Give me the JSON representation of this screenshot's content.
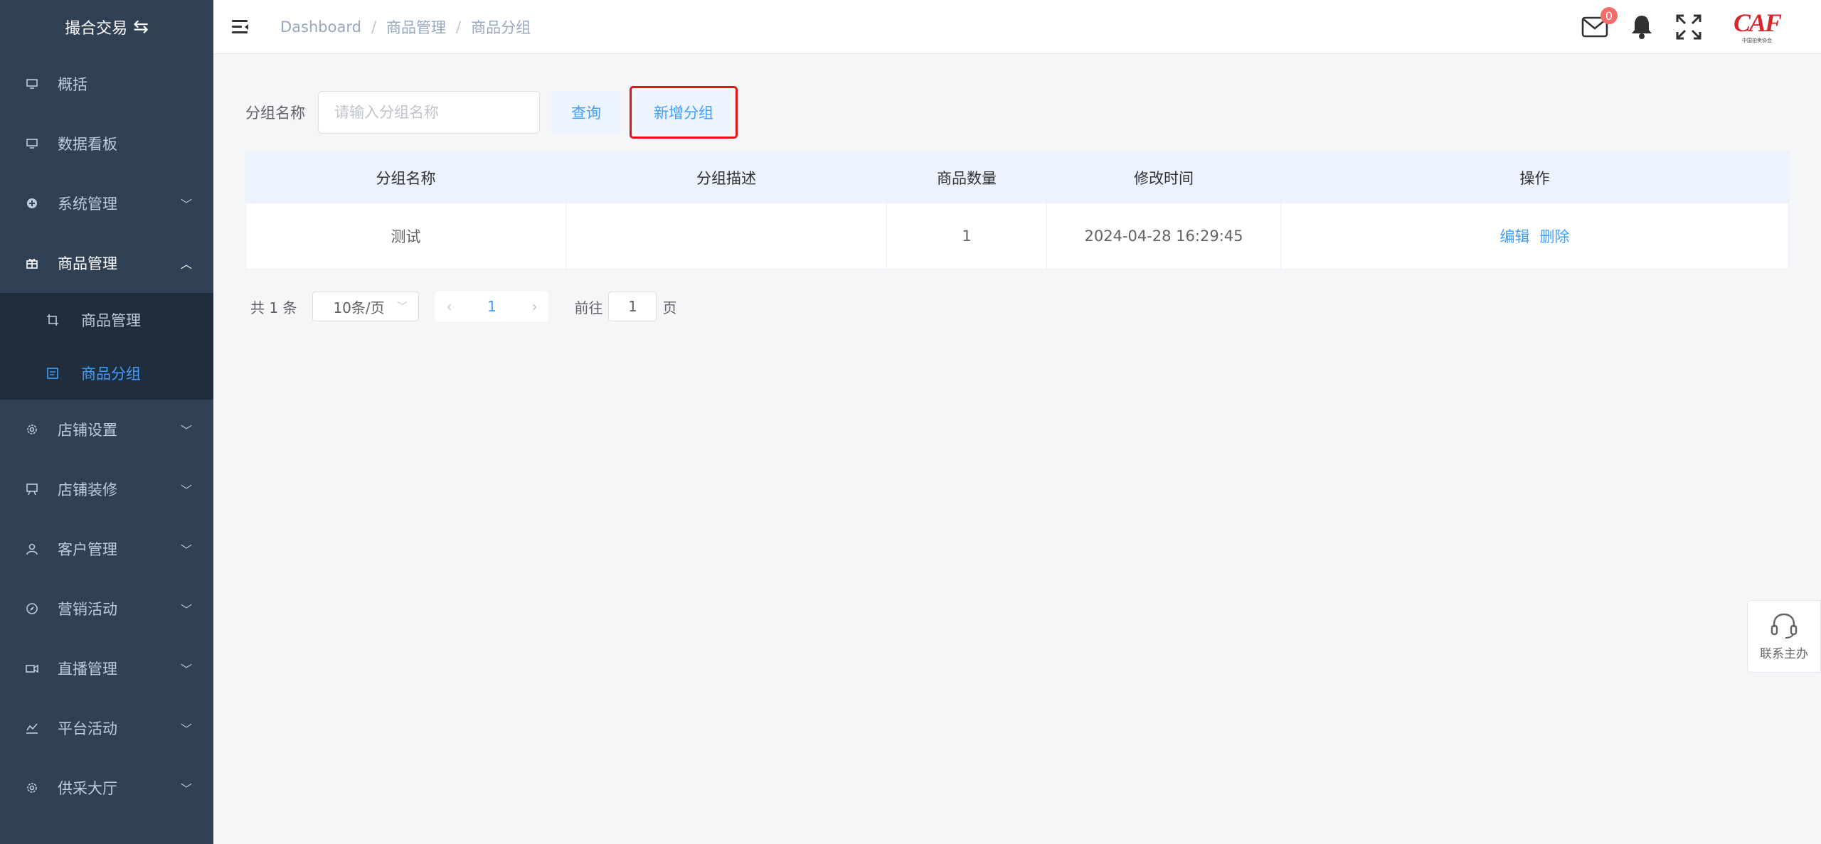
{
  "brand": {
    "title": "撮合交易",
    "swap_icon": "swap-icon"
  },
  "sidebar": {
    "items": [
      {
        "label": "概括",
        "icon": "monitor-icon",
        "has_children": false
      },
      {
        "label": "数据看板",
        "icon": "monitor-icon",
        "has_children": false
      },
      {
        "label": "系统管理",
        "icon": "plus-circle-icon",
        "has_children": true
      },
      {
        "label": "商品管理",
        "icon": "gift-icon",
        "has_children": true,
        "open": true,
        "children": [
          {
            "label": "商品管理",
            "icon": "crop-icon",
            "active": false
          },
          {
            "label": "商品分组",
            "icon": "document-icon",
            "active": true
          }
        ]
      },
      {
        "label": "店铺设置",
        "icon": "gear-icon",
        "has_children": true
      },
      {
        "label": "店铺装修",
        "icon": "easel-icon",
        "has_children": true
      },
      {
        "label": "客户管理",
        "icon": "user-icon",
        "has_children": true
      },
      {
        "label": "营销活动",
        "icon": "compass-icon",
        "has_children": true
      },
      {
        "label": "直播管理",
        "icon": "video-camera-icon",
        "has_children": true
      },
      {
        "label": "平台活动",
        "icon": "chart-icon",
        "has_children": true
      },
      {
        "label": "供采大厅",
        "icon": "gear-icon",
        "has_children": true
      }
    ]
  },
  "header": {
    "breadcrumb": [
      "Dashboard",
      "商品管理",
      "商品分组"
    ],
    "mail_count": "0",
    "logo_text": "CAF",
    "logo_subtext": "中国拍卖协会"
  },
  "filter": {
    "label": "分组名称",
    "placeholder": "请输入分组名称",
    "value": "",
    "query_label": "查询",
    "add_label": "新增分组"
  },
  "table": {
    "columns": [
      "分组名称",
      "分组描述",
      "商品数量",
      "修改时间",
      "操作"
    ],
    "rows": [
      {
        "name": "测试",
        "description": "",
        "count": "1",
        "modified": "2024-04-28 16:29:45",
        "actions": [
          "编辑",
          "删除"
        ]
      }
    ]
  },
  "pagination": {
    "total_text": "共 1 条",
    "page_size": "10条/页",
    "current_page": "1",
    "goto_label": "前往",
    "goto_value": "1",
    "page_suffix": "页"
  },
  "contact": {
    "label": "联系主办"
  },
  "colors": {
    "sidebar_bg": "#304156",
    "accent": "#409eff",
    "highlight_border": "#e6101b"
  }
}
